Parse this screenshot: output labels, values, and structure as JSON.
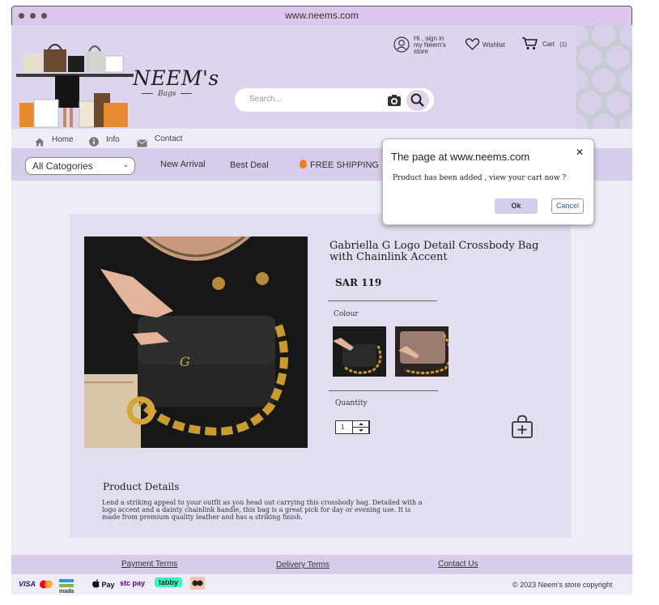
{
  "browser": {
    "url": "www.neems.com"
  },
  "brand": {
    "name": "NEEM's",
    "tagline": "Bags"
  },
  "search": {
    "placeholder": "Search..."
  },
  "account": {
    "signin_line1": "Hi , sign in",
    "signin_line2": "my Neem's",
    "signin_line3": "store",
    "wishlist": "Wishlist",
    "cart": "Cart",
    "cart_count": "(1)"
  },
  "topnav": {
    "home": "Home",
    "info": "Info",
    "contact": "Contact"
  },
  "catbar": {
    "select_value": "All Catogories",
    "new_arrival": "New Arrival",
    "best_deal": "Best Deal",
    "free_shipping": "FREE SHIPPING"
  },
  "product": {
    "title": "Gabriella G Logo Detail Crossbody Bag with Chainlink Accent",
    "price": "SAR 119",
    "colour_label": "Colour",
    "colours": [
      "black-icon",
      "taupe-icon"
    ],
    "quantity_label": "Quantity",
    "quantity": "1",
    "details_title": "Product Details",
    "details_text": "Lend a striking appeal to your outfit as you head out carrying this crossbody bag. Detailed with a logo accent and a dainty chainlink handle, this bag is a great pick for day or evening use. It is made from premium quality leather and has a striking finish."
  },
  "footer": {
    "payment_terms": "Payment Terms",
    "delivery_terms": "Delivery Terms",
    "contact_us": "Contact Us",
    "payments": [
      "VISA",
      "mada",
      "Pay",
      "stc pay",
      "tabby"
    ],
    "copyright": "© 2023 Neem's store copyright"
  },
  "dialog": {
    "title": "The page at www.neems.com",
    "message": "Product has been added , view your cart now ?",
    "ok": "Ok",
    "cancel": "Cancel"
  },
  "colors": {
    "accent": "#d7cdea",
    "header": "#ddd4ee",
    "titlebar": "#dcc6ec",
    "background": "#efecf7"
  }
}
